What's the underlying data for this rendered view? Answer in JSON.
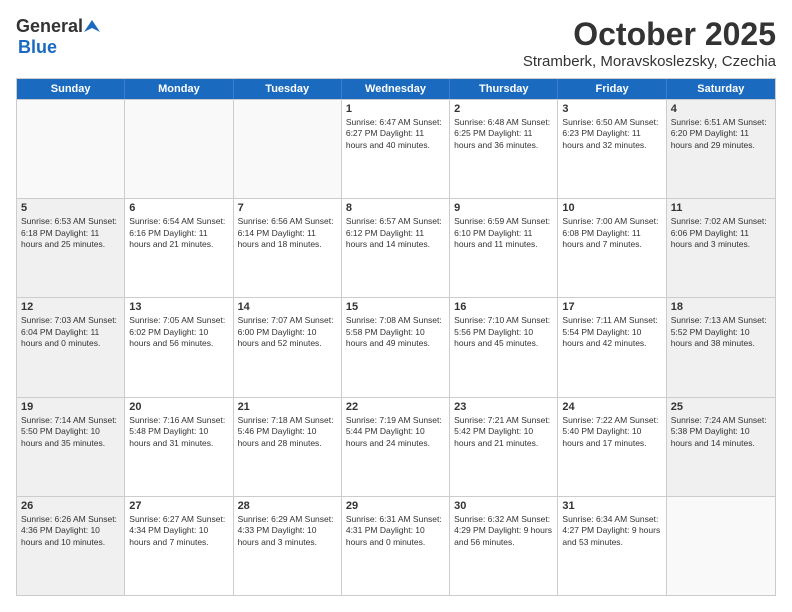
{
  "logo": {
    "general": "General",
    "blue": "Blue"
  },
  "title": "October 2025",
  "location": "Stramberk, Moravskoslezsky, Czechia",
  "days": [
    "Sunday",
    "Monday",
    "Tuesday",
    "Wednesday",
    "Thursday",
    "Friday",
    "Saturday"
  ],
  "weeks": [
    [
      {
        "day": "",
        "text": ""
      },
      {
        "day": "",
        "text": ""
      },
      {
        "day": "",
        "text": ""
      },
      {
        "day": "1",
        "text": "Sunrise: 6:47 AM\nSunset: 6:27 PM\nDaylight: 11 hours\nand 40 minutes."
      },
      {
        "day": "2",
        "text": "Sunrise: 6:48 AM\nSunset: 6:25 PM\nDaylight: 11 hours\nand 36 minutes."
      },
      {
        "day": "3",
        "text": "Sunrise: 6:50 AM\nSunset: 6:23 PM\nDaylight: 11 hours\nand 32 minutes."
      },
      {
        "day": "4",
        "text": "Sunrise: 6:51 AM\nSunset: 6:20 PM\nDaylight: 11 hours\nand 29 minutes."
      }
    ],
    [
      {
        "day": "5",
        "text": "Sunrise: 6:53 AM\nSunset: 6:18 PM\nDaylight: 11 hours\nand 25 minutes."
      },
      {
        "day": "6",
        "text": "Sunrise: 6:54 AM\nSunset: 6:16 PM\nDaylight: 11 hours\nand 21 minutes."
      },
      {
        "day": "7",
        "text": "Sunrise: 6:56 AM\nSunset: 6:14 PM\nDaylight: 11 hours\nand 18 minutes."
      },
      {
        "day": "8",
        "text": "Sunrise: 6:57 AM\nSunset: 6:12 PM\nDaylight: 11 hours\nand 14 minutes."
      },
      {
        "day": "9",
        "text": "Sunrise: 6:59 AM\nSunset: 6:10 PM\nDaylight: 11 hours\nand 11 minutes."
      },
      {
        "day": "10",
        "text": "Sunrise: 7:00 AM\nSunset: 6:08 PM\nDaylight: 11 hours\nand 7 minutes."
      },
      {
        "day": "11",
        "text": "Sunrise: 7:02 AM\nSunset: 6:06 PM\nDaylight: 11 hours\nand 3 minutes."
      }
    ],
    [
      {
        "day": "12",
        "text": "Sunrise: 7:03 AM\nSunset: 6:04 PM\nDaylight: 11 hours\nand 0 minutes."
      },
      {
        "day": "13",
        "text": "Sunrise: 7:05 AM\nSunset: 6:02 PM\nDaylight: 10 hours\nand 56 minutes."
      },
      {
        "day": "14",
        "text": "Sunrise: 7:07 AM\nSunset: 6:00 PM\nDaylight: 10 hours\nand 52 minutes."
      },
      {
        "day": "15",
        "text": "Sunrise: 7:08 AM\nSunset: 5:58 PM\nDaylight: 10 hours\nand 49 minutes."
      },
      {
        "day": "16",
        "text": "Sunrise: 7:10 AM\nSunset: 5:56 PM\nDaylight: 10 hours\nand 45 minutes."
      },
      {
        "day": "17",
        "text": "Sunrise: 7:11 AM\nSunset: 5:54 PM\nDaylight: 10 hours\nand 42 minutes."
      },
      {
        "day": "18",
        "text": "Sunrise: 7:13 AM\nSunset: 5:52 PM\nDaylight: 10 hours\nand 38 minutes."
      }
    ],
    [
      {
        "day": "19",
        "text": "Sunrise: 7:14 AM\nSunset: 5:50 PM\nDaylight: 10 hours\nand 35 minutes."
      },
      {
        "day": "20",
        "text": "Sunrise: 7:16 AM\nSunset: 5:48 PM\nDaylight: 10 hours\nand 31 minutes."
      },
      {
        "day": "21",
        "text": "Sunrise: 7:18 AM\nSunset: 5:46 PM\nDaylight: 10 hours\nand 28 minutes."
      },
      {
        "day": "22",
        "text": "Sunrise: 7:19 AM\nSunset: 5:44 PM\nDaylight: 10 hours\nand 24 minutes."
      },
      {
        "day": "23",
        "text": "Sunrise: 7:21 AM\nSunset: 5:42 PM\nDaylight: 10 hours\nand 21 minutes."
      },
      {
        "day": "24",
        "text": "Sunrise: 7:22 AM\nSunset: 5:40 PM\nDaylight: 10 hours\nand 17 minutes."
      },
      {
        "day": "25",
        "text": "Sunrise: 7:24 AM\nSunset: 5:38 PM\nDaylight: 10 hours\nand 14 minutes."
      }
    ],
    [
      {
        "day": "26",
        "text": "Sunrise: 6:26 AM\nSunset: 4:36 PM\nDaylight: 10 hours\nand 10 minutes."
      },
      {
        "day": "27",
        "text": "Sunrise: 6:27 AM\nSunset: 4:34 PM\nDaylight: 10 hours\nand 7 minutes."
      },
      {
        "day": "28",
        "text": "Sunrise: 6:29 AM\nSunset: 4:33 PM\nDaylight: 10 hours\nand 3 minutes."
      },
      {
        "day": "29",
        "text": "Sunrise: 6:31 AM\nSunset: 4:31 PM\nDaylight: 10 hours\nand 0 minutes."
      },
      {
        "day": "30",
        "text": "Sunrise: 6:32 AM\nSunset: 4:29 PM\nDaylight: 9 hours\nand 56 minutes."
      },
      {
        "day": "31",
        "text": "Sunrise: 6:34 AM\nSunset: 4:27 PM\nDaylight: 9 hours\nand 53 minutes."
      },
      {
        "day": "",
        "text": ""
      }
    ]
  ]
}
